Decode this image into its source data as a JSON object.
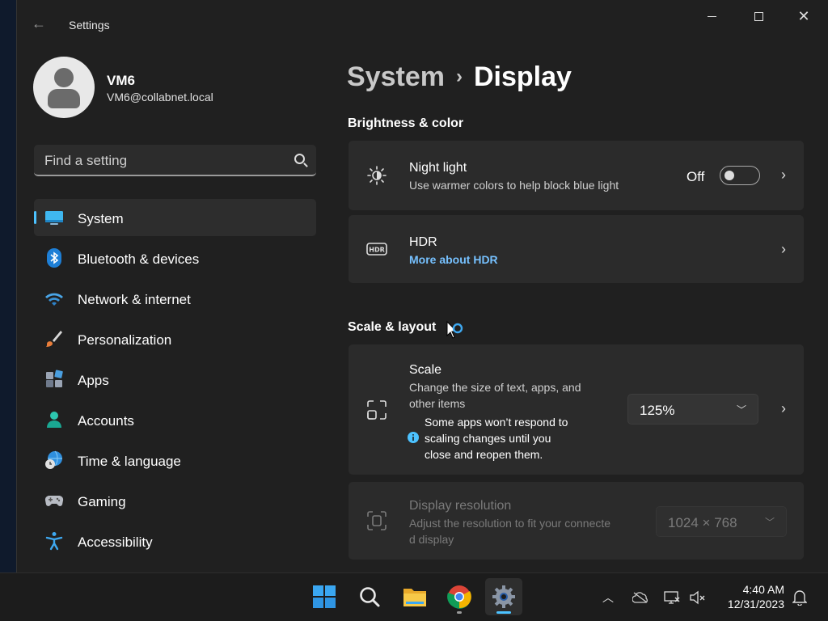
{
  "window": {
    "title": "Settings",
    "back_icon": "back-arrow-icon"
  },
  "profile": {
    "name": "VM6",
    "email": "VM6@collabnet.local"
  },
  "search": {
    "placeholder": "Find a setting"
  },
  "sidebar": {
    "items": [
      {
        "label": "System",
        "icon": "system-monitor-icon",
        "active": true
      },
      {
        "label": "Bluetooth & devices",
        "icon": "bluetooth-icon"
      },
      {
        "label": "Network & internet",
        "icon": "wifi-icon"
      },
      {
        "label": "Personalization",
        "icon": "paintbrush-icon"
      },
      {
        "label": "Apps",
        "icon": "apps-icon"
      },
      {
        "label": "Accounts",
        "icon": "person-icon"
      },
      {
        "label": "Time & language",
        "icon": "globe-clock-icon"
      },
      {
        "label": "Gaming",
        "icon": "gamepad-icon"
      },
      {
        "label": "Accessibility",
        "icon": "accessibility-icon"
      }
    ]
  },
  "breadcrumb": {
    "parent": "System",
    "separator": "›",
    "current": "Display"
  },
  "sections": {
    "brightness": {
      "title": "Brightness & color"
    },
    "scale_layout": {
      "title": "Scale & layout"
    }
  },
  "night_light": {
    "title": "Night light",
    "subtitle": "Use warmer colors to help block blue light",
    "toggle_label": "Off",
    "enabled": false
  },
  "hdr": {
    "title": "HDR",
    "link": "More about HDR"
  },
  "scale": {
    "title": "Scale",
    "subtitle_line1": "Change the size of text, apps, and",
    "subtitle_line2": "other items",
    "info_line1": "Some apps won’t respond to",
    "info_line2": "scaling changes until you",
    "info_line3": "close and reopen them.",
    "value": "125%"
  },
  "resolution": {
    "title": "Display resolution",
    "subtitle_line1": "Adjust the resolution to fit your connecte",
    "subtitle_line2": "d display",
    "value": "1024 × 768"
  },
  "taskbar": {
    "apps": [
      "start-icon",
      "search-icon",
      "file-explorer-icon",
      "chrome-icon",
      "settings-icon"
    ],
    "tray": [
      "chevron-up-icon",
      "onedrive-icon",
      "network-icon",
      "volume-muted-icon",
      "notifications-icon"
    ],
    "time": "4:40 AM",
    "date": "12/31/2023"
  },
  "colors": {
    "accent": "#4cc2ff",
    "link": "#76c1ff",
    "window_bg": "#202020",
    "card_bg": "#2b2b2b"
  }
}
